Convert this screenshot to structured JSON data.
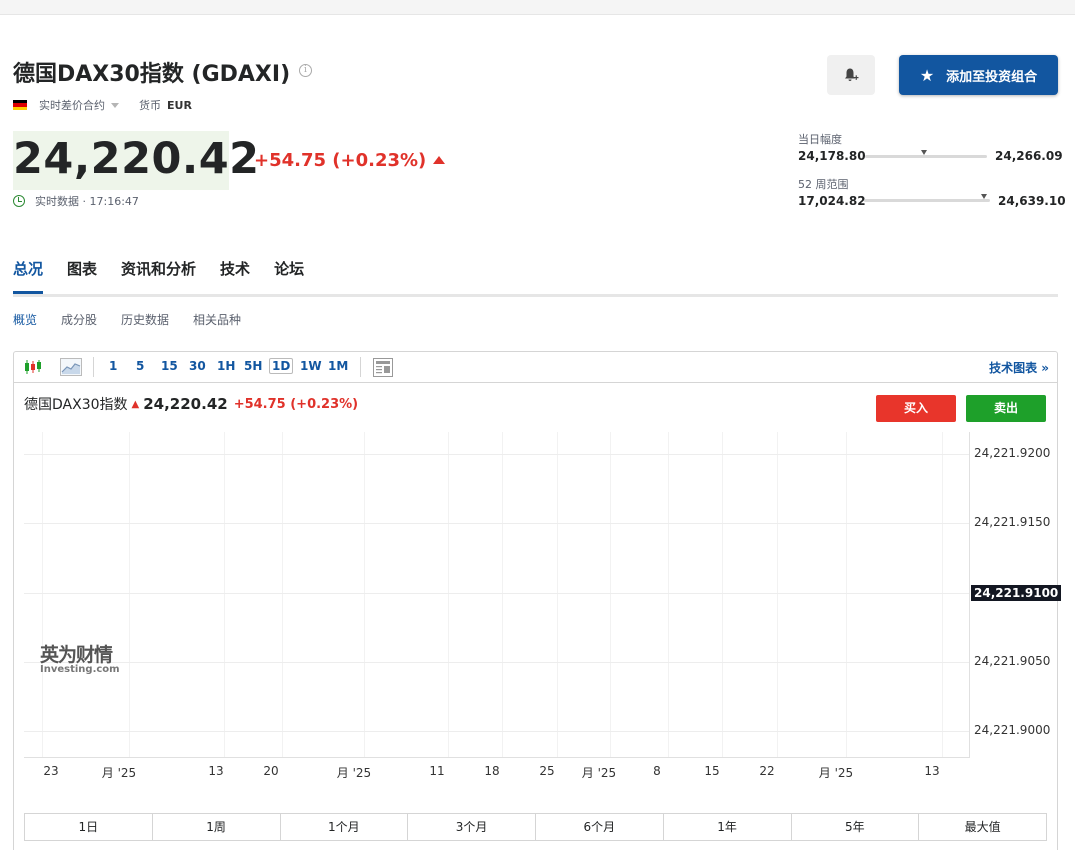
{
  "instrument": {
    "title": "德国DAX30指数 (GDAXI)",
    "info_icon": "info-icon",
    "type_label": "实时差价合约",
    "currency_label": "货币",
    "currency": "EUR",
    "flag_colors": [
      "#000000",
      "#dd0000",
      "#ffce00"
    ]
  },
  "header_actions": {
    "alert_icon": "bell-plus-icon",
    "portfolio_label": "添加至投资组合",
    "portfolio_icon": "star-icon"
  },
  "quote": {
    "price": "24,220.42",
    "change": "+54.75 (+0.23%)",
    "direction": "up",
    "time_label": "实时数据 · 17:16:47"
  },
  "ranges": {
    "day": {
      "label": "当日幅度",
      "low": "24,178.80",
      "high": "24,266.09",
      "position": 0.48
    },
    "week52": {
      "label": "52 周范围",
      "low": "17,024.82",
      "high": "24,639.10",
      "position": 0.95
    }
  },
  "tabs": [
    {
      "label": "总况",
      "active": true
    },
    {
      "label": "图表",
      "active": false
    },
    {
      "label": "资讯和分析",
      "active": false
    },
    {
      "label": "技术",
      "active": false
    },
    {
      "label": "论坛",
      "active": false
    }
  ],
  "subtabs": [
    {
      "label": "概览",
      "active": true
    },
    {
      "label": "成分股",
      "active": false
    },
    {
      "label": "历史数据",
      "active": false
    },
    {
      "label": "相关品种",
      "active": false
    }
  ],
  "chart_toolbar": {
    "intervals": [
      "1",
      "5",
      "15",
      "30",
      "1H",
      "5H",
      "1D",
      "1W",
      "1M"
    ],
    "selected_interval": "1D",
    "technical_chart_label": "技术图表 »"
  },
  "chart_legend": {
    "name": "德国DAX30指数",
    "price": "24,220.42",
    "change": "+54.75 (+0.23%)"
  },
  "trade": {
    "buy_label": "买入",
    "sell_label": "卖出"
  },
  "chart_data": {
    "type": "line",
    "y_ticks": [
      "24,221.9200",
      "24,221.9150",
      "24,221.9050",
      "24,221.9000"
    ],
    "current_value_label": "24,221.9100",
    "current_value": 24221.91,
    "ylim": [
      24221.896,
      24221.9225
    ],
    "x_ticks": [
      "23",
      "月 '25",
      "13",
      "20",
      "月 '25",
      "11",
      "18",
      "25",
      "月 '25",
      "8",
      "15",
      "22",
      "月 '25",
      "13"
    ],
    "watermark_cn": "英为财情",
    "watermark_en": "Investing.com"
  },
  "periods": [
    "1日",
    "1周",
    "1个月",
    "3个月",
    "6个月",
    "1年",
    "5年",
    "最大值"
  ]
}
